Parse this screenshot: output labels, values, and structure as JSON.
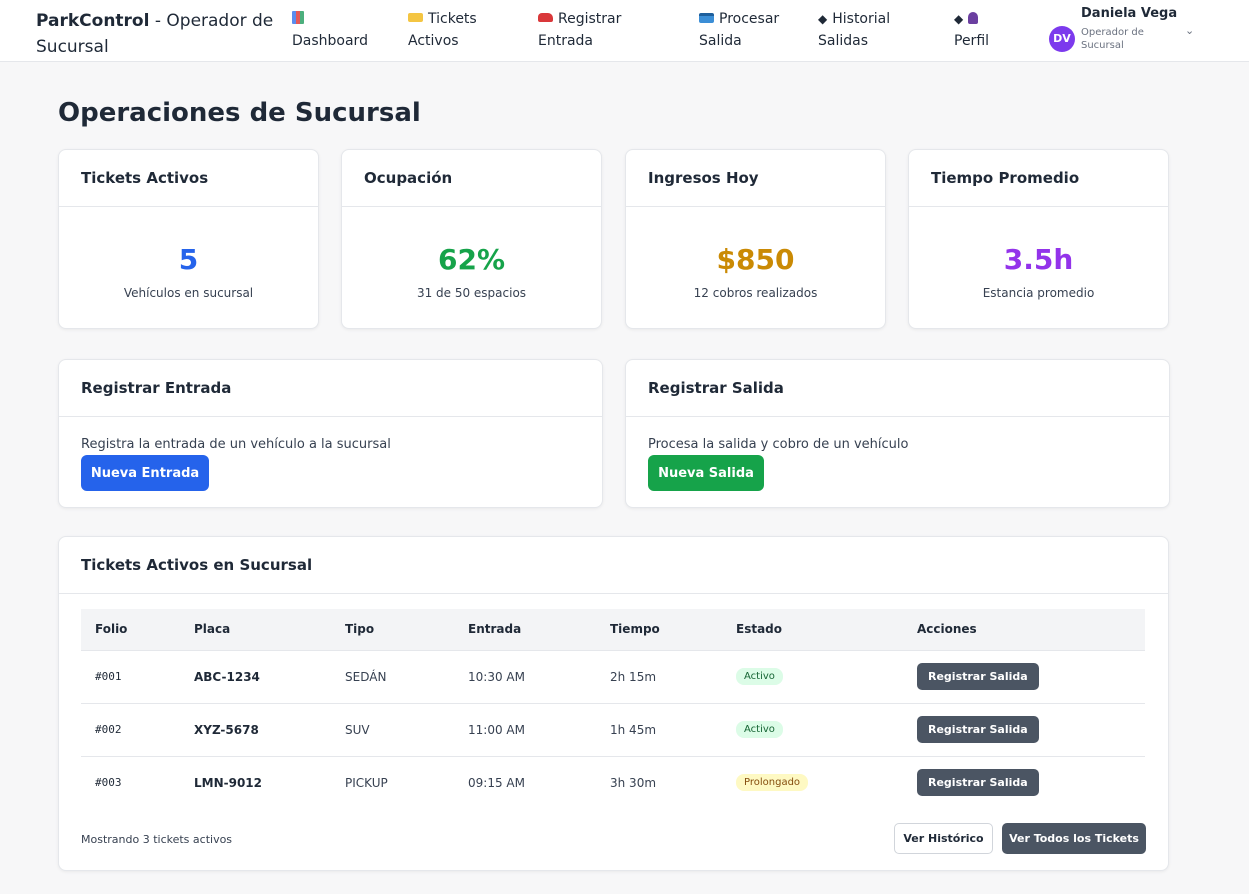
{
  "brand": {
    "name": "ParkControl",
    "suffix": " - Operador de Sucursal"
  },
  "nav": [
    {
      "icon": "chart-icon",
      "line1": "",
      "line2": "Dashboard"
    },
    {
      "icon": "ticket-icon",
      "line1": "Tickets",
      "line2": "Activos"
    },
    {
      "icon": "car-icon",
      "line1": "Registrar",
      "line2": "Entrada"
    },
    {
      "icon": "credit-card-icon",
      "line1": "Procesar",
      "line2": "Salida"
    },
    {
      "icon": "diamond-icon",
      "line1": "Historial",
      "line2": "Salidas"
    },
    {
      "icon": "user-icon",
      "line1": "",
      "line2": "Perfil"
    }
  ],
  "user": {
    "initials": "DV",
    "name": "Daniela Vega",
    "role": "Operador de Sucursal",
    "avatar_color": "#7c3aed"
  },
  "page_title": "Operaciones de Sucursal",
  "stats": [
    {
      "title": "Tickets Activos",
      "value": "5",
      "sub": "Vehículos en sucursal",
      "color": "#2563eb"
    },
    {
      "title": "Ocupación",
      "value": "62%",
      "sub": "31 de 50 espacios",
      "color": "#16a34a"
    },
    {
      "title": "Ingresos Hoy",
      "value": "$850",
      "sub": "12 cobros realizados",
      "color": "#ca8a04"
    },
    {
      "title": "Tiempo Promedio",
      "value": "3.5h",
      "sub": "Estancia promedio",
      "color": "#9333ea"
    }
  ],
  "actions": {
    "entrada": {
      "title": "Registrar Entrada",
      "text": "Registra la entrada de un vehículo a la sucursal",
      "button": "Nueva Entrada"
    },
    "salida": {
      "title": "Registrar Salida",
      "text": "Procesa la salida y cobro de un vehículo",
      "button": "Nueva Salida"
    }
  },
  "tickets": {
    "title": "Tickets Activos en Sucursal",
    "columns": [
      "Folio",
      "Placa",
      "Tipo",
      "Entrada",
      "Tiempo",
      "Estado",
      "Acciones"
    ],
    "rows": [
      {
        "folio": "#001",
        "placa": "ABC-1234",
        "tipo": "SEDÁN",
        "entrada": "10:30 AM",
        "tiempo": "2h 15m",
        "estado": "Activo",
        "accion": "Registrar Salida"
      },
      {
        "folio": "#002",
        "placa": "XYZ-5678",
        "tipo": "SUV",
        "entrada": "11:00 AM",
        "tiempo": "1h 45m",
        "estado": "Activo",
        "accion": "Registrar Salida"
      },
      {
        "folio": "#003",
        "placa": "LMN-9012",
        "tipo": "PICKUP",
        "entrada": "09:15 AM",
        "tiempo": "3h 30m",
        "estado": "Prolongado",
        "accion": "Registrar Salida"
      }
    ],
    "footer": "Mostrando 3 tickets activos",
    "btn_history": "Ver Histórico",
    "btn_all": "Ver Todos los Tickets"
  }
}
